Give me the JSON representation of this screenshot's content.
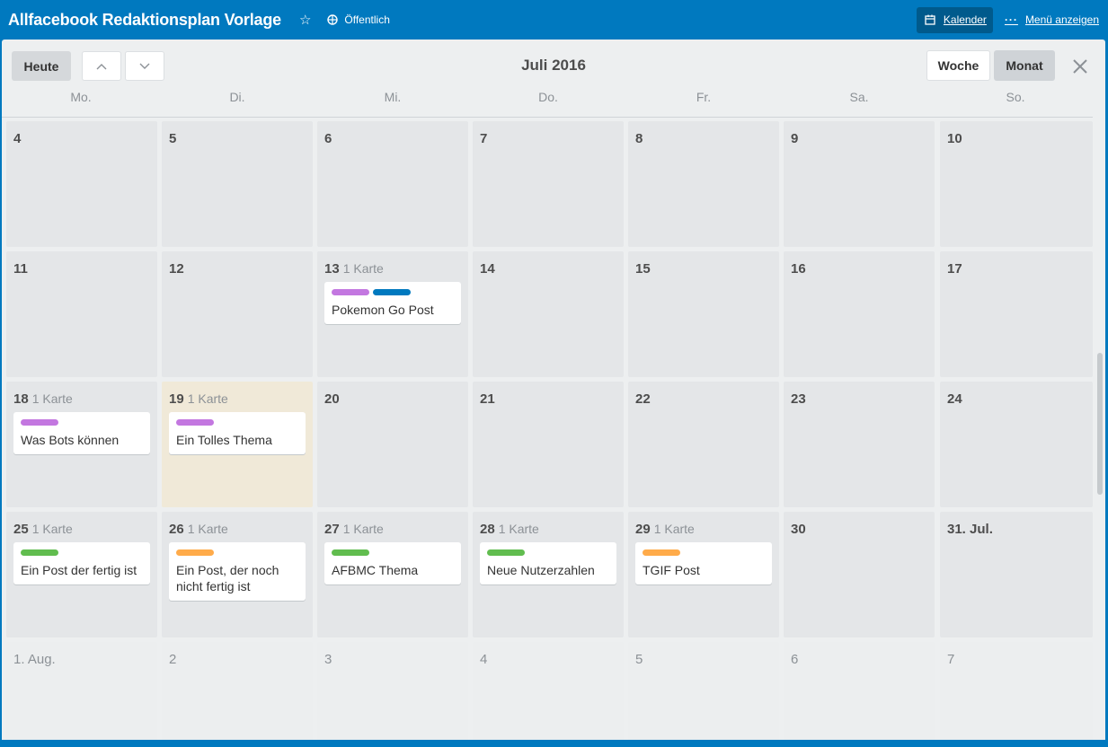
{
  "header": {
    "board_title": "Allfacebook Redaktionsplan Vorlage",
    "visibility_label": "Öffentlich",
    "calendar_label": "Kalender",
    "menu_label": "Menü anzeigen"
  },
  "toolbar": {
    "today_label": "Heute",
    "month_title": "Juli 2016",
    "week_label": "Woche",
    "month_label": "Monat"
  },
  "weekdays": [
    "Mo.",
    "Di.",
    "Mi.",
    "Do.",
    "Fr.",
    "Sa.",
    "So."
  ],
  "colors": {
    "purple": "#c377e0",
    "blue": "#0079bf",
    "green": "#61bd4f",
    "orange": "#ffab4a",
    "board_bg": "#0079bf"
  },
  "weeks": [
    [
      {
        "day": "4"
      },
      {
        "day": "5"
      },
      {
        "day": "6"
      },
      {
        "day": "7"
      },
      {
        "day": "8"
      },
      {
        "day": "9"
      },
      {
        "day": "10"
      }
    ],
    [
      {
        "day": "11"
      },
      {
        "day": "12"
      },
      {
        "day": "13",
        "count": "1 Karte",
        "card": {
          "title": "Pokemon Go Post",
          "labels": [
            "purple",
            "blue"
          ]
        }
      },
      {
        "day": "14"
      },
      {
        "day": "15"
      },
      {
        "day": "16"
      },
      {
        "day": "17"
      }
    ],
    [
      {
        "day": "18",
        "count": "1 Karte",
        "card": {
          "title": "Was Bots können",
          "labels": [
            "purple"
          ]
        }
      },
      {
        "day": "19",
        "count": "1 Karte",
        "today": true,
        "card": {
          "title": "Ein Tolles Thema",
          "labels": [
            "purple"
          ]
        }
      },
      {
        "day": "20"
      },
      {
        "day": "21"
      },
      {
        "day": "22"
      },
      {
        "day": "23"
      },
      {
        "day": "24"
      }
    ],
    [
      {
        "day": "25",
        "count": "1 Karte",
        "card": {
          "title": "Ein Post der fertig ist",
          "labels": [
            "green"
          ]
        }
      },
      {
        "day": "26",
        "count": "1 Karte",
        "card": {
          "title": "Ein Post, der noch nicht fertig ist",
          "labels": [
            "orange"
          ]
        }
      },
      {
        "day": "27",
        "count": "1 Karte",
        "card": {
          "title": "AFBMC Thema",
          "labels": [
            "green"
          ]
        }
      },
      {
        "day": "28",
        "count": "1 Karte",
        "card": {
          "title": "Neue Nutzerzahlen",
          "labels": [
            "green"
          ]
        }
      },
      {
        "day": "29",
        "count": "1 Karte",
        "card": {
          "title": "TGIF Post",
          "labels": [
            "orange"
          ]
        }
      },
      {
        "day": "30"
      },
      {
        "day": "31. Jul."
      }
    ],
    [
      {
        "day": "1. Aug.",
        "other": true
      },
      {
        "day": "2",
        "other": true
      },
      {
        "day": "3",
        "other": true
      },
      {
        "day": "4",
        "other": true
      },
      {
        "day": "5",
        "other": true
      },
      {
        "day": "6",
        "other": true
      },
      {
        "day": "7",
        "other": true
      }
    ]
  ]
}
